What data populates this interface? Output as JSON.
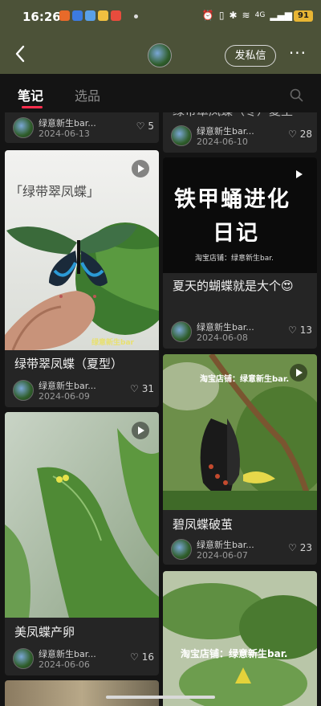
{
  "status": {
    "time": "16:26",
    "battery": "91",
    "signal": "4G"
  },
  "header": {
    "dm_label": "发私信",
    "more": "···"
  },
  "tabs": [
    {
      "label": "笔记"
    },
    {
      "label": "选品"
    }
  ],
  "colors": {
    "accent": "#ff2e4d",
    "header_bg": "#4c5238",
    "page_bg": "#141414",
    "card_bg": "#252525"
  },
  "left_column": [
    {
      "author": "绿意新生bar...",
      "date": "2024-06-13",
      "likes": "5"
    },
    {
      "image_caption": "「绿带翠凤蝶」",
      "watermark": "绿意新生bar",
      "title": "绿带翠凤蝶（夏型）",
      "author": "绿意新生bar...",
      "date": "2024-06-09",
      "likes": "31"
    },
    {
      "title": "美凤蝶产卵",
      "author": "绿意新生bar...",
      "date": "2024-06-06",
      "likes": "16"
    }
  ],
  "right_column": [
    {
      "title_partial": "绿带翠凤蝶（冬）夏至",
      "author": "绿意新生bar...",
      "date": "2024-06-10",
      "likes": "28"
    },
    {
      "image_text_line1": "铁甲蛹进化",
      "image_text_line2": "日记",
      "image_subtext": "淘宝店铺：绿意新生bar.",
      "title": "夏天的蝴蝶就是大个😍",
      "author": "绿意新生bar...",
      "date": "2024-06-08",
      "likes": "13"
    },
    {
      "image_watermark": "淘宝店铺：绿意新生bar.",
      "title": "碧凤蝶破茧",
      "author": "绿意新生bar...",
      "date": "2024-06-07",
      "likes": "23"
    },
    {
      "image_watermark": "淘宝店铺：绿意新生bar."
    }
  ]
}
